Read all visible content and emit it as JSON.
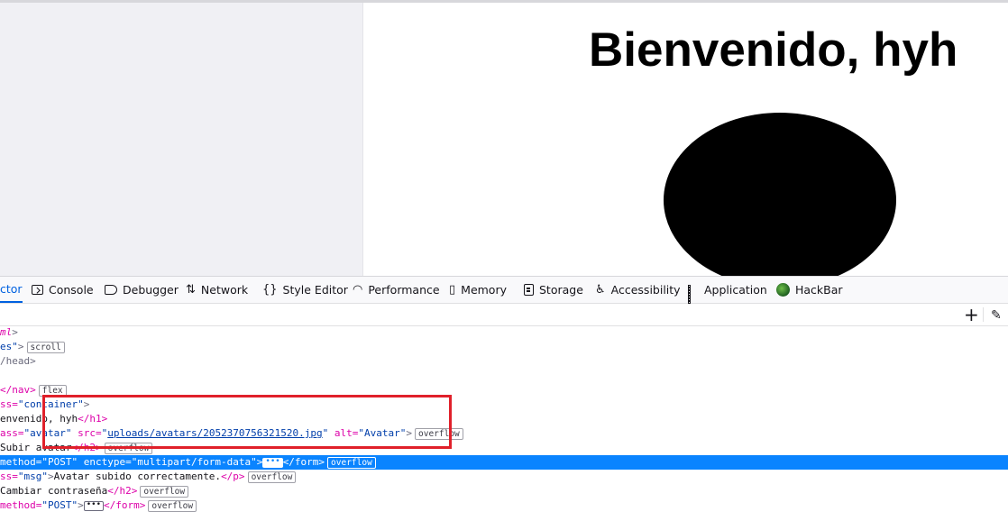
{
  "page": {
    "title": "Bienvenido, hyh"
  },
  "devtools": {
    "tabs": [
      {
        "label": "ctor",
        "icon": ""
      },
      {
        "label": "Console",
        "icon": "console-icon"
      },
      {
        "label": "Debugger",
        "icon": "debugger-icon"
      },
      {
        "label": "Network",
        "icon": "network-icon"
      },
      {
        "label": "Style Editor",
        "icon": "style-editor-icon"
      },
      {
        "label": "Performance",
        "icon": "performance-icon"
      },
      {
        "label": "Memory",
        "icon": "memory-icon"
      },
      {
        "label": "Storage",
        "icon": "storage-icon"
      },
      {
        "label": "Accessibility",
        "icon": "accessibility-icon"
      },
      {
        "label": "Application",
        "icon": "application-icon"
      },
      {
        "label": "HackBar",
        "icon": "hackbar-icon"
      }
    ],
    "tree": {
      "l1": {
        "a": "ml",
        "b": ">"
      },
      "l2": {
        "a": "es\"",
        "b": ">",
        "badge": "scroll"
      },
      "l3": {
        "a": "/head>"
      },
      "l5": {
        "a": "</nav>",
        "badge": "flex"
      },
      "l6": {
        "a": "ss=",
        "val": "\"container\"",
        "b": ">"
      },
      "l7": {
        "a": "envenido, hyh",
        "b": "</h1>"
      },
      "l8": {
        "a": "ass=",
        "val": "\"avatar\"",
        "attr2": " src=",
        "q1": "\"",
        "link": "uploads/avatars/2052370756321520.jpg",
        "q2": "\"",
        "attr3": " alt=",
        "val3": "\"Avatar\"",
        "b": ">",
        "badge": "overflow"
      },
      "l9": {
        "a": "Subir avatar",
        "b": "</h2>",
        "badge": "overflow"
      },
      "l10": {
        "a": "method=",
        "val": "\"POST\"",
        "attr2": " enctype=",
        "val2": "\"multipart/form-data\"",
        "b": ">",
        "ellip": "•••",
        "c": "</form>",
        "badge": "overflow"
      },
      "l11": {
        "a": "ss=",
        "val": "\"msg\"",
        "b": ">",
        "t": "Avatar subido correctamente.",
        "c": "</p>",
        "badge": "overflow"
      },
      "l12": {
        "a": "Cambiar contraseña",
        "b": "</h2>",
        "badge": "overflow"
      },
      "l13": {
        "a": "method=",
        "val": "\"POST\"",
        "b": ">",
        "ellip": "•••",
        "c": "</form>",
        "badge": "overflow"
      }
    },
    "toolbar": {
      "add": "+",
      "pick": "✎"
    }
  },
  "colors": {
    "selection": "#0a84ff",
    "highlight_box": "#e0202a",
    "tag": "#dd00a9",
    "attr_value": "#003eaa"
  }
}
